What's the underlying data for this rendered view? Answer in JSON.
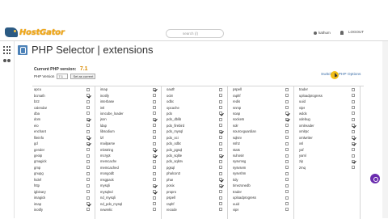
{
  "header": {
    "logo_text": "HostGator",
    "search_placeholder": "search (/)",
    "username": "kathum",
    "logout_label": "LOGOUT"
  },
  "page": {
    "title": "PHP Selector | extensions",
    "current_label": "Current PHP version:",
    "current_version": "7.1",
    "php_version_label": "PHP Version",
    "selected_version": "7.1",
    "set_current_label": "Set as current",
    "switch_link": "Switch To PHP Options"
  },
  "extensions": [
    [
      {
        "n": "apcu",
        "c": false
      },
      {
        "n": "bcmath",
        "c": true
      },
      {
        "n": "bz2",
        "c": false
      },
      {
        "n": "calendar",
        "c": false
      },
      {
        "n": "dba",
        "c": false
      },
      {
        "n": "dom",
        "c": true
      },
      {
        "n": "eio",
        "c": false
      },
      {
        "n": "enchant",
        "c": false
      },
      {
        "n": "fileinfo",
        "c": true
      },
      {
        "n": "gd",
        "c": true
      },
      {
        "n": "gender",
        "c": false
      },
      {
        "n": "geoip",
        "c": false
      },
      {
        "n": "gmagick",
        "c": false
      },
      {
        "n": "gmp",
        "c": false
      },
      {
        "n": "gnupg",
        "c": false
      },
      {
        "n": "hidef",
        "c": false
      },
      {
        "n": "http",
        "c": false
      },
      {
        "n": "igbinary",
        "c": false
      },
      {
        "n": "imagick",
        "c": false
      },
      {
        "n": "imap",
        "c": true
      },
      {
        "n": "inotify",
        "c": false
      }
    ],
    [
      {
        "n": "imap",
        "c": true
      },
      {
        "n": "inotify",
        "c": false
      },
      {
        "n": "interbase",
        "c": false
      },
      {
        "n": "intl",
        "c": false
      },
      {
        "n": "ioncube_loader",
        "c": false
      },
      {
        "n": "json",
        "c": true
      },
      {
        "n": "ldap",
        "c": false
      },
      {
        "n": "libsodium",
        "c": false
      },
      {
        "n": "lzf",
        "c": false
      },
      {
        "n": "mailparse",
        "c": false
      },
      {
        "n": "mbstring",
        "c": true
      },
      {
        "n": "mcrypt",
        "c": true
      },
      {
        "n": "memcache",
        "c": false
      },
      {
        "n": "memcached",
        "c": false
      },
      {
        "n": "mongodb",
        "c": false
      },
      {
        "n": "msgpack",
        "c": false
      },
      {
        "n": "mysqli",
        "c": true
      },
      {
        "n": "mysqlnd",
        "c": true
      },
      {
        "n": "nd_mysqli",
        "c": false
      },
      {
        "n": "nd_pdo_mysql",
        "c": false
      },
      {
        "n": "newrelic",
        "c": false
      }
    ],
    [
      {
        "n": "oauth",
        "c": false
      },
      {
        "n": "oci8",
        "c": false
      },
      {
        "n": "odbc",
        "c": false
      },
      {
        "n": "opcache",
        "c": false
      },
      {
        "n": "pdo",
        "c": true
      },
      {
        "n": "pdo_dblib",
        "c": false
      },
      {
        "n": "pdo_firebird",
        "c": false
      },
      {
        "n": "pdo_mysql",
        "c": true
      },
      {
        "n": "pdo_oci",
        "c": false
      },
      {
        "n": "pdo_odbc",
        "c": false
      },
      {
        "n": "pdo_pgsql",
        "c": false
      },
      {
        "n": "pdo_sqlite",
        "c": true
      },
      {
        "n": "pdo_sqlsrv",
        "c": false
      },
      {
        "n": "pgsql",
        "c": false
      },
      {
        "n": "phalcon3",
        "c": false
      },
      {
        "n": "phar",
        "c": true
      },
      {
        "n": "posix",
        "c": true
      },
      {
        "n": "propro",
        "c": false
      },
      {
        "n": "pspell",
        "c": false
      },
      {
        "n": "raphf",
        "c": false
      },
      {
        "n": "recode",
        "c": false
      }
    ],
    [
      {
        "n": "pspell",
        "c": false
      },
      {
        "n": "raphf",
        "c": false
      },
      {
        "n": "redis",
        "c": false
      },
      {
        "n": "snmp",
        "c": false
      },
      {
        "n": "soap",
        "c": true
      },
      {
        "n": "sockets",
        "c": true
      },
      {
        "n": "solr",
        "c": false
      },
      {
        "n": "sourceguardian",
        "c": false
      },
      {
        "n": "sqlsrv",
        "c": false
      },
      {
        "n": "ssh2",
        "c": false
      },
      {
        "n": "stats",
        "c": false
      },
      {
        "n": "suhosin",
        "c": false
      },
      {
        "n": "sysvmsg",
        "c": false
      },
      {
        "n": "sysvsem",
        "c": false
      },
      {
        "n": "sysvshm",
        "c": false
      },
      {
        "n": "tidy",
        "c": false
      },
      {
        "n": "timezonedb",
        "c": false
      },
      {
        "n": "trader",
        "c": false
      },
      {
        "n": "uploadprogress",
        "c": false
      },
      {
        "n": "uuid",
        "c": false
      },
      {
        "n": "vips",
        "c": false
      }
    ],
    [
      {
        "n": "trader",
        "c": false
      },
      {
        "n": "uploadprogress",
        "c": false
      },
      {
        "n": "uuid",
        "c": false
      },
      {
        "n": "vips",
        "c": false
      },
      {
        "n": "wddx",
        "c": false
      },
      {
        "n": "xdebug",
        "c": false
      },
      {
        "n": "xmlreader",
        "c": true
      },
      {
        "n": "xmlrpc",
        "c": false
      },
      {
        "n": "xmlwriter",
        "c": true
      },
      {
        "n": "xsl",
        "c": true
      },
      {
        "n": "yaf",
        "c": false
      },
      {
        "n": "yaml",
        "c": false
      },
      {
        "n": "zip",
        "c": true
      },
      {
        "n": "zmq",
        "c": false
      }
    ]
  ]
}
